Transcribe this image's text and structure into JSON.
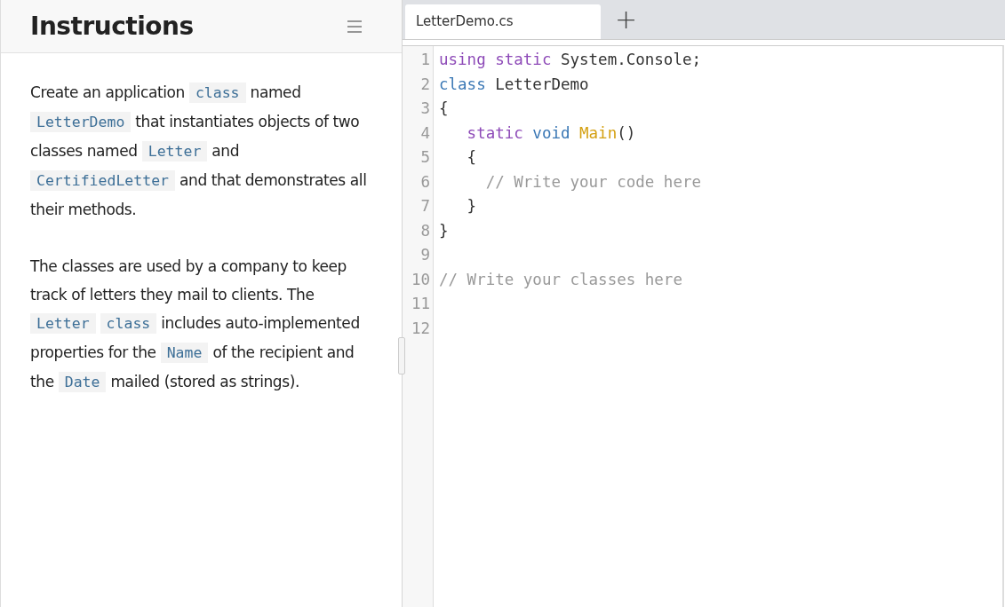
{
  "instructions": {
    "title": "Instructions",
    "paragraphs": [
      [
        {
          "kind": "text",
          "text": "Create an application "
        },
        {
          "kind": "code",
          "text": "class"
        },
        {
          "kind": "text",
          "text": " named "
        },
        {
          "kind": "code",
          "text": "LetterDemo"
        },
        {
          "kind": "text",
          "text": " that instantiates objects of two classes named "
        },
        {
          "kind": "code",
          "text": "Letter"
        },
        {
          "kind": "text",
          "text": " and "
        },
        {
          "kind": "code",
          "text": "CertifiedLetter"
        },
        {
          "kind": "text",
          "text": " and that demonstrates all their methods."
        }
      ],
      [
        {
          "kind": "text",
          "text": "The classes are used by a company to keep track of letters they mail to clients. The "
        },
        {
          "kind": "code",
          "text": "Letter"
        },
        {
          "kind": "gap"
        },
        {
          "kind": "code",
          "text": "class"
        },
        {
          "kind": "text",
          "text": " includes auto-implemented properties for the "
        },
        {
          "kind": "code",
          "text": "Name"
        },
        {
          "kind": "text",
          "text": " of the recipient and the "
        },
        {
          "kind": "code",
          "text": "Date"
        },
        {
          "kind": "text",
          "text": " mailed (stored as strings)."
        }
      ]
    ]
  },
  "tabs": [
    {
      "label": "LetterDemo.cs",
      "selected": true
    }
  ],
  "new_tab": "+",
  "editor": {
    "lines": [
      {
        "number": "1",
        "tokens": [
          {
            "kind": "keyword",
            "text": "using static"
          },
          {
            "kind": "plain",
            "text": " System.Console;"
          }
        ]
      },
      {
        "number": "2",
        "tokens": [
          {
            "kind": "type",
            "text": "class"
          },
          {
            "kind": "plain",
            "text": " LetterDemo"
          }
        ]
      },
      {
        "number": "3",
        "tokens": [
          {
            "kind": "plain",
            "text": "{"
          }
        ]
      },
      {
        "number": "4",
        "tokens": [
          {
            "kind": "keyword",
            "text": "   static"
          },
          {
            "kind": "type",
            "text": " void"
          },
          {
            "kind": "function",
            "text": " Main"
          },
          {
            "kind": "plain",
            "text": "()"
          }
        ]
      },
      {
        "number": "5",
        "tokens": [
          {
            "kind": "plain",
            "text": "   {"
          }
        ]
      },
      {
        "number": "6",
        "tokens": [
          {
            "kind": "comment",
            "text": "     // Write your code here"
          }
        ]
      },
      {
        "number": "7",
        "tokens": [
          {
            "kind": "plain",
            "text": "   }"
          }
        ]
      },
      {
        "number": "8",
        "tokens": [
          {
            "kind": "plain",
            "text": "}"
          }
        ]
      },
      {
        "number": "9"
      },
      {
        "number": "10",
        "tokens": [
          {
            "kind": "comment",
            "text": "// Write your classes here"
          }
        ]
      },
      {
        "number": "11"
      },
      {
        "number": "12"
      }
    ]
  }
}
